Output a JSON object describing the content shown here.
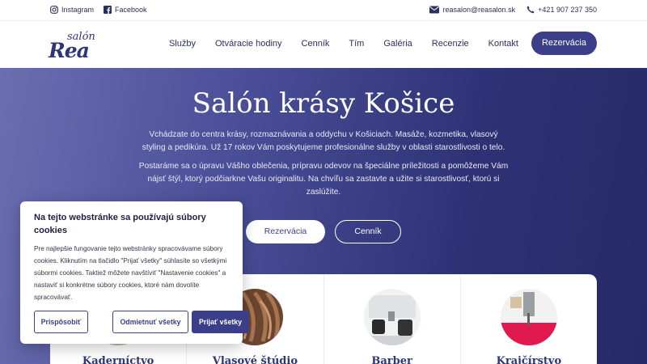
{
  "topbar": {
    "instagram_label": "Instagram",
    "facebook_label": "Facebook",
    "email": "reasalon@reasalon.sk",
    "phone": "+421 907 237 350"
  },
  "header": {
    "logo_small": "salón",
    "logo_big": "Rea",
    "nav": [
      "Služby",
      "Otváracie hodiny",
      "Cenník",
      "Tím",
      "Galéria",
      "Recenzie",
      "Kontakt"
    ],
    "cta_label": "Rezervácia"
  },
  "hero": {
    "title": "Salón krásy Košice",
    "paragraph1": "Vchádzate do centra krásy, rozmaznávania a oddychu v Košiciach. Masáže, kozmetika, vlasový styling a pedikúra. Už 17 rokov Vám poskytujeme profesionálne služby v oblasti starostlivosti o telo.",
    "paragraph2": "Postaráme sa o úpravu Vášho oblečenia, prípravu odevov na špeciálne príležitosti a pomôžeme Vám nájsť štýl, ktorý podčiarkne Vašu originalitu. Na chvíľu sa zastavte a užite si starostlivosť, ktorú si zaslúžite.",
    "btn_reservation": "Rezervácia",
    "btn_pricelist": "Cenník"
  },
  "services": [
    {
      "title": "Kaderníctvo"
    },
    {
      "title": "Vlasové štúdio"
    },
    {
      "title": "Barber"
    },
    {
      "title": "Krajčírstvo"
    }
  ],
  "cookie": {
    "title": "Na tejto webstránke sa používajú súbory cookies",
    "text": "Pre najlepšie fungovanie tejto webstránky spracovávame súbory cookies. Kliknutím na tlačidlo \"Prijať všetky\" súhlasíte so všetkými súbormi cookies. Taktiež môžete navštíviť \"Nastavenie cookies\" a nastaviť si konkrétne súbory cookies, ktoré nám dovolíte spracovávať.",
    "btn_preferences": "Prispôsobiť",
    "btn_reject": "Odmietnuť všetky",
    "btn_accept": "Prijať všetky"
  },
  "colors": {
    "brand": "#3b3f8a",
    "hero_gradient_start": "#6b6fb0",
    "hero_gradient_end": "#262a66"
  },
  "icons": {
    "instagram": "instagram-icon",
    "facebook": "facebook-icon",
    "email": "mail-icon",
    "phone": "phone-icon"
  }
}
